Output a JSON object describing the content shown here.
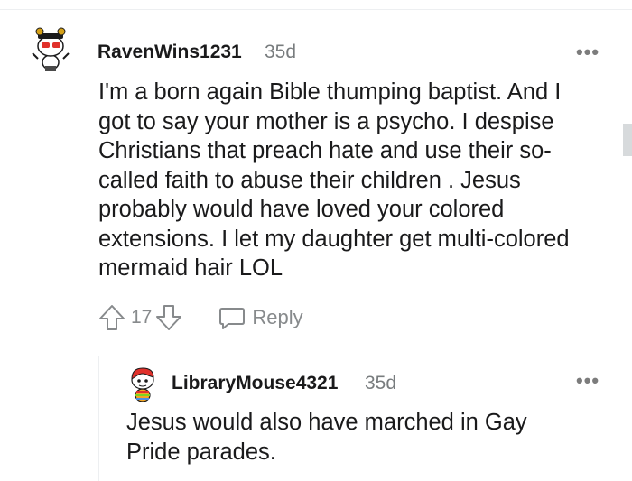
{
  "comments": [
    {
      "avatar": "snoo-avatar-red-hat",
      "username": "RavenWins1231",
      "age": "35d",
      "more": "•••",
      "lines": [
        "I'm a born again Bible thumping baptist. And I",
        "got to say your mother is a psycho. I despise",
        "Christians that preach hate and use their so-",
        "called faith to abuse their children . Jesus",
        "probably would have loved your colored",
        "extensions. I let my daughter get multi-colored",
        "mermaid hair LOL"
      ],
      "votes": "17",
      "reply_label": "Reply",
      "icons": {
        "upvote": "upvote-arrow-icon",
        "downvote": "downvote-arrow-icon",
        "reply": "speech-bubble-icon",
        "more": "ellipsis-icon"
      }
    },
    {
      "avatar": "snoo-avatar-rainbow",
      "username": "LibraryMouse4321",
      "age": "35d",
      "more": "•••",
      "lines": [
        "Jesus would also have marched in Gay",
        "Pride parades."
      ]
    }
  ],
  "colors": {
    "text": "#1a1a1b",
    "meta": "#787c7e",
    "icon": "#878a8c",
    "divider": "#edeff1"
  }
}
